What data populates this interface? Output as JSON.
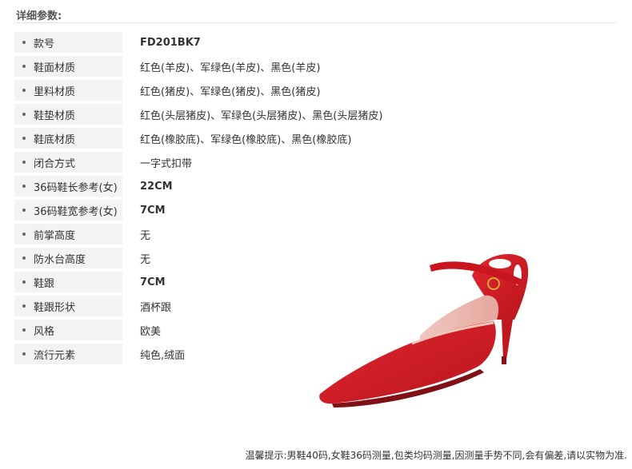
{
  "section_title": "详细参数:",
  "specs": [
    {
      "label": "款号",
      "value": "FD201BK7"
    },
    {
      "label": "鞋面材质",
      "value": "红色(羊皮)、军绿色(羊皮)、黑色(羊皮)"
    },
    {
      "label": "里料材质",
      "value": "红色(猪皮)、军绿色(猪皮)、黑色(猪皮)"
    },
    {
      "label": "鞋垫材质",
      "value": "红色(头层猪皮)、军绿色(头层猪皮)、黑色(头层猪皮)"
    },
    {
      "label": "鞋底材质",
      "value": "红色(橡胶底)、军绿色(橡胶底)、黑色(橡胶底)"
    },
    {
      "label": "闭合方式",
      "value": "一字式扣带"
    },
    {
      "label": "36码鞋长参考(女)",
      "value": "22CM"
    },
    {
      "label": "36码鞋宽参考(女)",
      "value": "7CM"
    },
    {
      "label": "前掌高度",
      "value": "无"
    },
    {
      "label": "防水台高度",
      "value": "无"
    },
    {
      "label": "鞋跟",
      "value": "7CM"
    },
    {
      "label": "鞋跟形状",
      "value": "酒杯跟"
    },
    {
      "label": "风格",
      "value": "欧美"
    },
    {
      "label": "流行元素",
      "value": "纯色,绒面"
    }
  ],
  "product_image": {
    "icon": "red-pointed-toe-ankle-strap-heel",
    "color": "#d8202a"
  },
  "footer_note": "温馨提示:男鞋40码,女鞋36码测量,包类均码测量,因测量手势不同,会有偏差,请以实物为准."
}
